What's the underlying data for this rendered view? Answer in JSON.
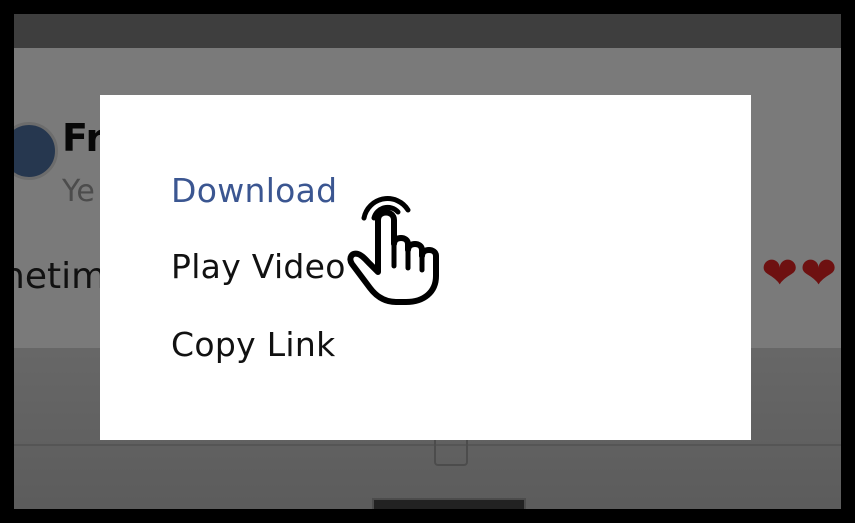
{
  "background": {
    "profile_name": "Freelanc",
    "profile_subtitle": "Ye",
    "post_text": "netim",
    "hearts": "❤❤",
    "heart_color": "#d22222"
  },
  "menu": {
    "items": [
      {
        "label": "Download",
        "highlighted": true
      },
      {
        "label": "Play Video",
        "highlighted": false
      },
      {
        "label": "Copy Link",
        "highlighted": false
      }
    ],
    "highlight_color": "#3b5691"
  },
  "cursor": {
    "icon": "pointing-hand-icon"
  }
}
